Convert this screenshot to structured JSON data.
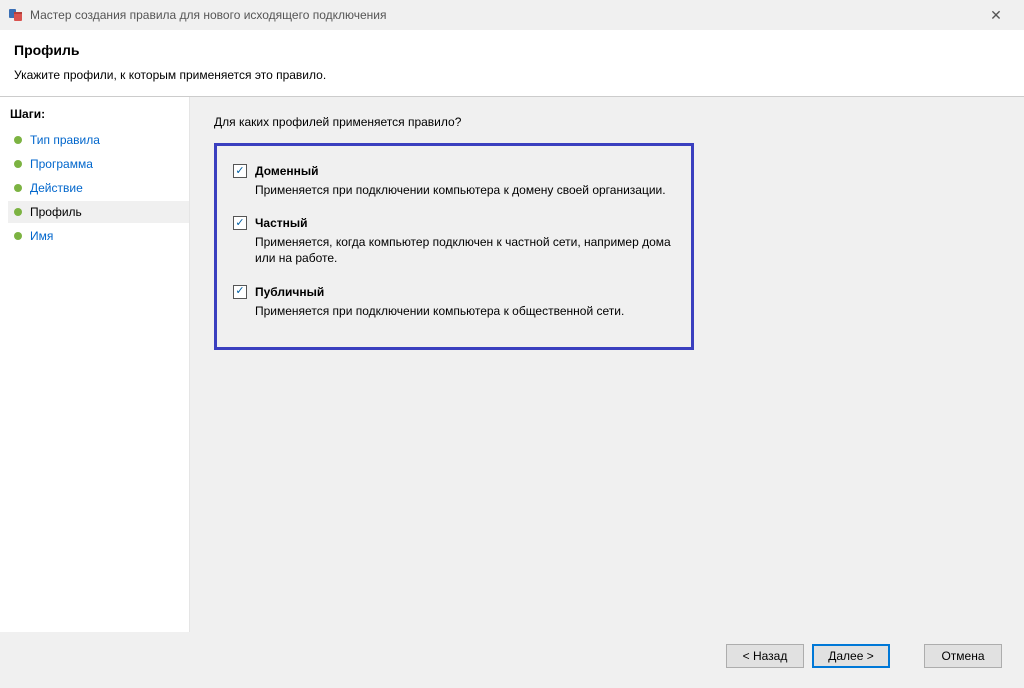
{
  "window": {
    "title": "Мастер создания правила для нового исходящего подключения"
  },
  "header": {
    "title": "Профиль",
    "subtitle": "Укажите профили, к которым применяется это правило."
  },
  "sidebar": {
    "title": "Шаги:",
    "steps": [
      {
        "label": "Тип правила"
      },
      {
        "label": "Программа"
      },
      {
        "label": "Действие"
      },
      {
        "label": "Профиль"
      },
      {
        "label": "Имя"
      }
    ]
  },
  "content": {
    "prompt": "Для каких профилей применяется правило?",
    "options": [
      {
        "title": "Доменный",
        "desc": "Применяется при подключении компьютера к домену своей организации.",
        "checked": true
      },
      {
        "title": "Частный",
        "desc": "Применяется, когда компьютер подключен к частной сети, например дома или на работе.",
        "checked": true
      },
      {
        "title": "Публичный",
        "desc": "Применяется при подключении компьютера к общественной сети.",
        "checked": true
      }
    ]
  },
  "footer": {
    "back": "< Назад",
    "next": "Далее >",
    "cancel": "Отмена"
  },
  "icons": {
    "check": "✓",
    "close": "✕"
  }
}
